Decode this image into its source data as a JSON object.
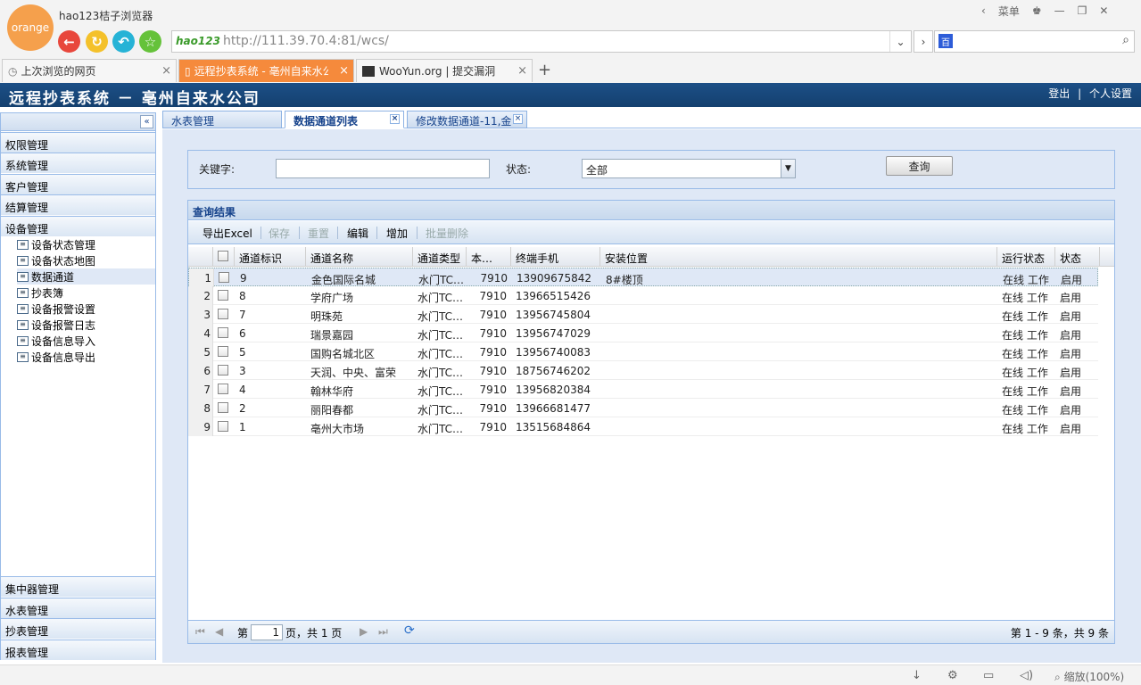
{
  "browser": {
    "logo_text": "orange",
    "title": "hao123桔子浏览器",
    "address_brand": "hao123",
    "url": "http://111.39.70.4:81/wcs/",
    "menu_label": "菜单",
    "tabs": [
      {
        "label": "上次浏览的网页"
      },
      {
        "label": "远程抄表系统 - 亳州自来水公"
      },
      {
        "label": "WooYun.org | 提交漏洞"
      }
    ],
    "new_tab": "+",
    "zoom": "缩放(100%)"
  },
  "app": {
    "title": "远程抄表系统 － 亳州自来水公司",
    "logout": "登出",
    "separator": "|",
    "settings": "个人设置"
  },
  "sidebar": {
    "groups_top": [
      "权限管理",
      "系统管理",
      "客户管理",
      "结算管理",
      "设备管理"
    ],
    "tree": [
      "设备状态管理",
      "设备状态地图",
      "数据通道",
      "抄表簿",
      "设备报警设置",
      "设备报警日志",
      "设备信息导入",
      "设备信息导出"
    ],
    "groups_bottom": [
      "集中器管理",
      "水表管理",
      "抄表管理",
      "报表管理"
    ]
  },
  "main_tabs": [
    "水表管理",
    "数据通道列表",
    "修改数据通道-11,金"
  ],
  "filter": {
    "keyword_label": "关键字:",
    "keyword_value": "",
    "status_label": "状态:",
    "status_value": "全部",
    "query_button": "查询"
  },
  "grid": {
    "title": "查询结果",
    "toolbar": [
      "导出Excel",
      "保存",
      "重置",
      "编辑",
      "增加",
      "批量删除"
    ],
    "columns": [
      "通道标识",
      "通道名称",
      "通道类型",
      "本…",
      "终端手机",
      "安装位置",
      "运行状态",
      "状态"
    ],
    "rows": [
      {
        "n": "1",
        "id": "9",
        "name": "金色国际名城",
        "type": "水门TC…",
        "code": "7910",
        "phone": "13909675842",
        "loc": "8#楼顶",
        "run": "在线 工作",
        "state": "启用"
      },
      {
        "n": "2",
        "id": "8",
        "name": "学府广场",
        "type": "水门TC…",
        "code": "7910",
        "phone": "13966515426",
        "loc": "",
        "run": "在线 工作",
        "state": "启用"
      },
      {
        "n": "3",
        "id": "7",
        "name": "明珠苑",
        "type": "水门TC…",
        "code": "7910",
        "phone": "13956745804",
        "loc": "",
        "run": "在线 工作",
        "state": "启用"
      },
      {
        "n": "4",
        "id": "6",
        "name": "瑞景嘉园",
        "type": "水门TC…",
        "code": "7910",
        "phone": "13956747029",
        "loc": "",
        "run": "在线 工作",
        "state": "启用"
      },
      {
        "n": "5",
        "id": "5",
        "name": "国购名城北区",
        "type": "水门TC…",
        "code": "7910",
        "phone": "13956740083",
        "loc": "",
        "run": "在线 工作",
        "state": "启用"
      },
      {
        "n": "6",
        "id": "3",
        "name": "天润、中央、富荣",
        "type": "水门TC…",
        "code": "7910",
        "phone": "18756746202",
        "loc": "",
        "run": "在线 工作",
        "state": "启用"
      },
      {
        "n": "7",
        "id": "4",
        "name": "翰林华府",
        "type": "水门TC…",
        "code": "7910",
        "phone": "13956820384",
        "loc": "",
        "run": "在线 工作",
        "state": "启用"
      },
      {
        "n": "8",
        "id": "2",
        "name": "丽阳春都",
        "type": "水门TC…",
        "code": "7910",
        "phone": "13966681477",
        "loc": "",
        "run": "在线 工作",
        "state": "启用"
      },
      {
        "n": "9",
        "id": "1",
        "name": "亳州大市场",
        "type": "水门TC…",
        "code": "7910",
        "phone": "13515684864",
        "loc": "",
        "run": "在线 工作",
        "state": "启用"
      }
    ],
    "pager": {
      "page_prefix": "第",
      "page_value": "1",
      "page_suffix": "页，共 1 页",
      "summary": "第 1 - 9 条，共 9 条"
    }
  }
}
